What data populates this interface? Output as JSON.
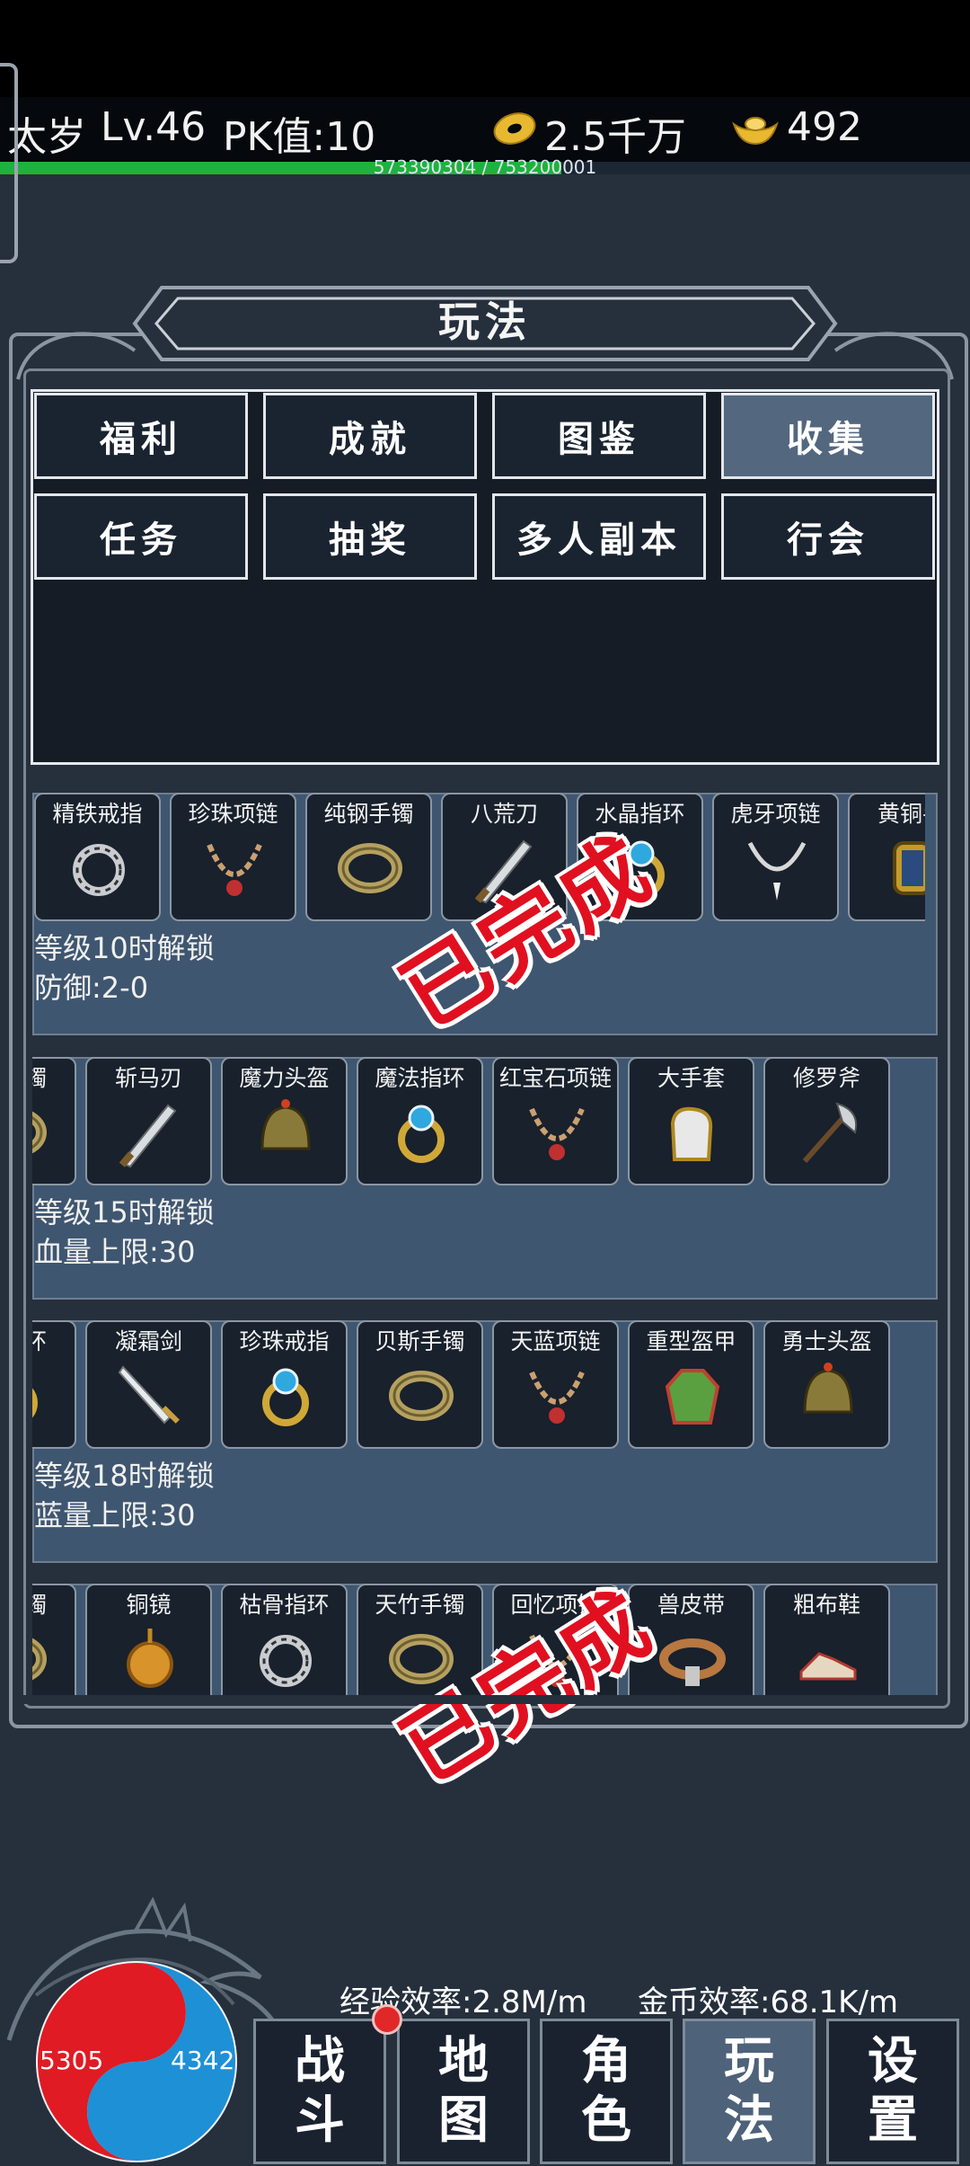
{
  "status": {
    "name": "太岁",
    "level": "Lv.46",
    "pk": "PK值:10",
    "gold": "2.5千万",
    "ingot": "492",
    "exp_text": "573390304 / 753200001",
    "exp_progress": 0.761
  },
  "panel": {
    "title": "玩法"
  },
  "menu": [
    {
      "label": "福利",
      "active": false
    },
    {
      "label": "成就",
      "active": false
    },
    {
      "label": "图鉴",
      "active": false
    },
    {
      "label": "收集",
      "active": true
    },
    {
      "label": "任务",
      "active": false
    },
    {
      "label": "抽奖",
      "active": false
    },
    {
      "label": "多人副本",
      "active": false
    },
    {
      "label": "行会",
      "active": false
    }
  ],
  "rows": [
    {
      "items": [
        "精铁戒指",
        "珍珠项链",
        "纯钢手镯",
        "八荒刀",
        "水晶指环",
        "虎牙项链",
        "黄铜手"
      ],
      "icons": [
        "ring-icon",
        "necklace-icon",
        "bracelet-icon",
        "blade-icon",
        "ring-gem-icon",
        "fang-necklace-icon",
        "bracer-icon"
      ],
      "unlock": "等级10时解锁",
      "bonus": "防御:2-0",
      "stamp": "已完成"
    },
    {
      "items": [
        "黄手镯",
        "斩马刃",
        "魔力头盔",
        "魔法指环",
        "红宝石项链",
        "大手套",
        "修罗斧"
      ],
      "icons": [
        "bracelet-icon",
        "blade-icon",
        "helmet-icon",
        "ring-gem-icon",
        "necklace-icon",
        "gauntlet-icon",
        "axe-icon"
      ],
      "unlock": "等级15时解锁",
      "bonus": "血量上限:30"
    },
    {
      "items": [
        "法手环",
        "凝霜剑",
        "珍珠戒指",
        "贝斯手镯",
        "天蓝项链",
        "重型盔甲",
        "勇士头盔"
      ],
      "icons": [
        "ring-gem-icon",
        "sword-icon",
        "ring-gem-icon",
        "bracelet-icon",
        "necklace-icon",
        "armor-icon",
        "helmet-icon"
      ],
      "unlock": "等级18时解锁",
      "bonus": "蓝量上限:30"
    },
    {
      "items": [
        "金手镯",
        "铜镜",
        "枯骨指环",
        "天竹手镯",
        "回忆项链",
        "兽皮带",
        "粗布鞋"
      ],
      "icons": [
        "bracelet-icon",
        "mirror-icon",
        "ring-icon",
        "bracelet-icon",
        "necklace-icon",
        "belt-icon",
        "boots-icon"
      ],
      "stamp": "已完成"
    }
  ],
  "efficiency": {
    "exp": "经验效率:2.8M/m",
    "gold": "金币效率:68.1K/m"
  },
  "orb": {
    "hp": "5305",
    "mp": "4342"
  },
  "nav": [
    {
      "l1": "战",
      "l2": "斗",
      "active": false
    },
    {
      "l1": "地",
      "l2": "图",
      "active": false
    },
    {
      "l1": "角",
      "l2": "色",
      "active": false
    },
    {
      "l1": "玩",
      "l2": "法",
      "active": true
    },
    {
      "l1": "设",
      "l2": "置",
      "active": false
    }
  ],
  "colors": {
    "hp": "#e01b24",
    "mp": "#1e90d6",
    "exp": "#1fb23a",
    "stamp": "#e01020",
    "active": "#53677f"
  }
}
